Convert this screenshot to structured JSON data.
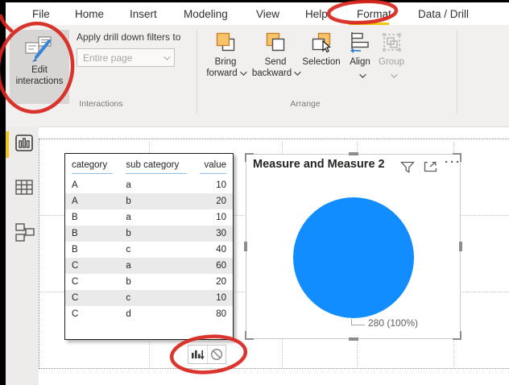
{
  "menu": {
    "items": [
      {
        "label": "File"
      },
      {
        "label": "Home"
      },
      {
        "label": "Insert"
      },
      {
        "label": "Modeling"
      },
      {
        "label": "View"
      },
      {
        "label": "Help"
      },
      {
        "label": "Format",
        "active": true
      },
      {
        "label": "Data / Drill"
      }
    ]
  },
  "ribbon": {
    "edit_interactions": {
      "line1": "Edit",
      "line2": "interactions"
    },
    "drill": {
      "label": "Apply drill down filters to",
      "value": "Entire page"
    },
    "group_labels": {
      "interactions": "Interactions",
      "arrange": "Arrange"
    },
    "arrange_buttons": [
      {
        "line1": "Bring",
        "line2": "forward",
        "chevron": true
      },
      {
        "line1": "Send",
        "line2": "backward",
        "chevron": true
      },
      {
        "line1": "Selection",
        "chevron": false
      },
      {
        "line1": "Align",
        "chevron": true
      },
      {
        "line1": "Group",
        "chevron": true,
        "disabled": true
      }
    ]
  },
  "sidebar": {
    "icons": [
      {
        "name": "report-view",
        "selected": true
      },
      {
        "name": "data-view",
        "selected": false
      },
      {
        "name": "model-view",
        "selected": false
      }
    ]
  },
  "table_visual": {
    "columns": [
      "category",
      "sub category",
      "value"
    ],
    "rows": [
      [
        "A",
        "a",
        "10"
      ],
      [
        "A",
        "b",
        "20"
      ],
      [
        "B",
        "a",
        "10"
      ],
      [
        "B",
        "b",
        "30"
      ],
      [
        "B",
        "c",
        "40"
      ],
      [
        "C",
        "a",
        "60"
      ],
      [
        "C",
        "b",
        "20"
      ],
      [
        "C",
        "c",
        "10"
      ],
      [
        "C",
        "d",
        "80"
      ]
    ]
  },
  "pie_visual": {
    "title": "Measure and Measure 2",
    "header_icons": [
      "filter-funnel",
      "focus-mode",
      "more-options"
    ],
    "more_options_glyph": "···",
    "data_label": "280 (100%)",
    "chart_data": {
      "type": "pie",
      "title": "Measure and Measure 2",
      "slices": [
        {
          "label": "280 (100%)",
          "value": 280,
          "percent": 100,
          "color": "#118DFF"
        }
      ],
      "legend": false
    }
  },
  "interaction_toolbar": {
    "icons": [
      {
        "name": "filter-interaction",
        "selected": true
      },
      {
        "name": "no-interaction",
        "selected": false
      }
    ]
  },
  "annotations": {
    "color": "#d8261c",
    "shapes": [
      "format-tab-circle",
      "edit-interactions-circle",
      "interaction-icons-circle"
    ]
  },
  "colors": {
    "accent_yellow": "#f2c80f",
    "pie_blue": "#118DFF",
    "ribbon_bg": "#f1f0ee",
    "annotation_red": "#d8261c",
    "table_alt_row": "#eaeaea",
    "header_underline": "#8fbfe8"
  }
}
